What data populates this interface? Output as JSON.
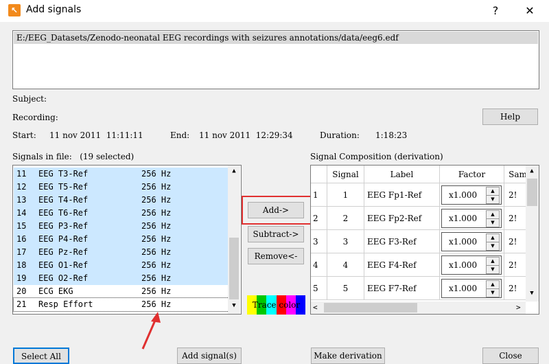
{
  "window": {
    "title": "Add signals",
    "help_glyph": "?",
    "close_glyph": "✕",
    "app_icon_glyph": "↖"
  },
  "file": {
    "path": "E:/EEG_Datasets/Zenodo-neonatal EEG recordings with seizures annotations/data/eeg6.edf"
  },
  "info": {
    "subject": "Subject:",
    "recording": "Recording:",
    "start_label": "Start:",
    "start_value": "11 nov 2011  11:11:11",
    "end_label": "End:",
    "end_value": "11 nov 2011  12:29:34",
    "duration_label": "Duration:",
    "duration_value": "1:18:23",
    "help_button": "Help"
  },
  "signals": {
    "header": "Signals in file:   (19 selected)",
    "rows": [
      {
        "n": "11",
        "name": "EEG T3-Ref",
        "rate": "256 Hz",
        "selected": true
      },
      {
        "n": "12",
        "name": "EEG T5-Ref",
        "rate": "256 Hz",
        "selected": true
      },
      {
        "n": "13",
        "name": "EEG T4-Ref",
        "rate": "256 Hz",
        "selected": true
      },
      {
        "n": "14",
        "name": "EEG T6-Ref",
        "rate": "256 Hz",
        "selected": true
      },
      {
        "n": "15",
        "name": "EEG P3-Ref",
        "rate": "256 Hz",
        "selected": true
      },
      {
        "n": "16",
        "name": "EEG P4-Ref",
        "rate": "256 Hz",
        "selected": true
      },
      {
        "n": "17",
        "name": "EEG Pz-Ref",
        "rate": "256 Hz",
        "selected": true
      },
      {
        "n": "18",
        "name": "EEG O1-Ref",
        "rate": "256 Hz",
        "selected": true
      },
      {
        "n": "19",
        "name": "EEG O2-Ref",
        "rate": "256 Hz",
        "selected": true
      },
      {
        "n": "20",
        "name": "ECG EKG",
        "rate": "256 Hz",
        "selected": false
      },
      {
        "n": "21",
        "name": "Resp Effort",
        "rate": "256 Hz",
        "selected": false
      }
    ]
  },
  "mid_buttons": {
    "add": "Add->",
    "subtract": "Subtract->",
    "remove": "Remove<-",
    "trace_color": "Trace color"
  },
  "composition": {
    "header": "Signal Composition (derivation)",
    "columns": [
      "Signal",
      "Label",
      "Factor",
      "Sam"
    ],
    "rows": [
      {
        "idx": "1",
        "signal": "1",
        "label": "EEG Fp1-Ref",
        "factor": "x1.000",
        "sam": "2!"
      },
      {
        "idx": "2",
        "signal": "2",
        "label": "EEG Fp2-Ref",
        "factor": "x1.000",
        "sam": "2!"
      },
      {
        "idx": "3",
        "signal": "3",
        "label": "EEG F3-Ref",
        "factor": "x1.000",
        "sam": "2!"
      },
      {
        "idx": "4",
        "signal": "4",
        "label": "EEG F4-Ref",
        "factor": "x1.000",
        "sam": "2!"
      },
      {
        "idx": "5",
        "signal": "5",
        "label": "EEG F7-Ref",
        "factor": "x1.000",
        "sam": "2!"
      }
    ]
  },
  "bottom_buttons": {
    "select_all": "Select All",
    "add_signals": "Add signal(s)",
    "make_derivation": "Make derivation",
    "close": "Close"
  },
  "colors": {
    "selection": "#cce8ff",
    "highlight": "#e03030",
    "annotation_arrow": "#e03030"
  }
}
